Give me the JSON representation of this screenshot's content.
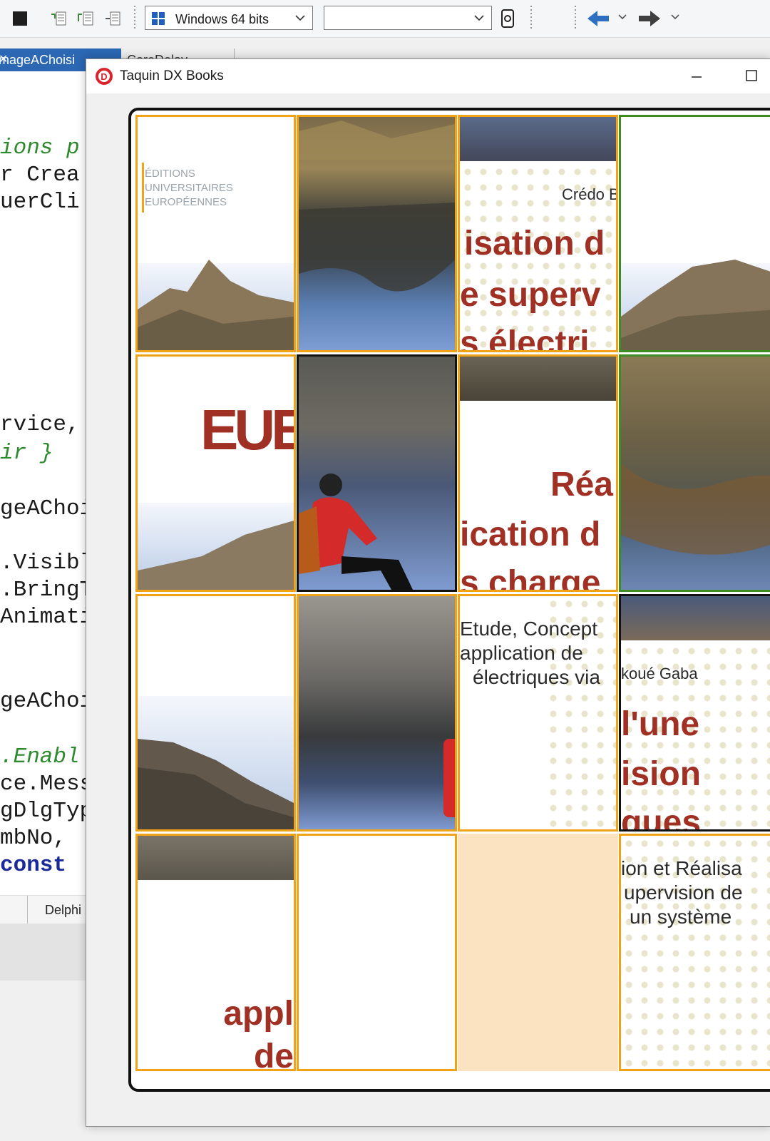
{
  "toolbar": {
    "platform_combo": "Windows 64 bits",
    "config_combo": ""
  },
  "ide": {
    "tabs": [
      {
        "label": "mageAChoisi"
      },
      {
        "label": "CoreDelay"
      }
    ],
    "code_lines": [
      {
        "text": "ions p",
        "style": "green"
      },
      {
        "text": "r Crea",
        "style": "plain"
      },
      {
        "text": "uerCli",
        "style": "plain"
      },
      {
        "text": "rvice,",
        "style": "plain"
      },
      {
        "text": "ir }",
        "style": "green"
      },
      {
        "text": "geAChoi",
        "style": "plain"
      },
      {
        "text": ".Visibl",
        "style": "plain"
      },
      {
        "text": ".BringT",
        "style": "plain"
      },
      {
        "text": "Animati",
        "style": "plain"
      },
      {
        "text": "geAChoi",
        "style": "plain"
      },
      {
        "text": ".Enabl",
        "style": "green"
      },
      {
        "text": "ce.Mess",
        "style": "plain"
      },
      {
        "text": "gDlgTyp",
        "style": "plain"
      },
      {
        "text": "mbNo,",
        "style": "plain"
      },
      {
        "text": "const",
        "style": "blue"
      }
    ],
    "status_tab": "Delphi"
  },
  "window": {
    "title": "Taquin DX Books",
    "app_icon_letter": "D",
    "minimize_glyph": "—",
    "maximize_glyph": "☐"
  },
  "book": {
    "publisher": [
      "ÉDITIONS",
      "UNIVERSITAIRES",
      "EUROPÉENNES"
    ],
    "logo": "EUE",
    "author_fragment_a": "Crédo B",
    "author_fragment_b": "koué Gaba",
    "title_fragments": {
      "t_r1c3_a": "isation d",
      "t_r1c3_b": "e superv",
      "t_r1c3_c": "s  électri",
      "t_r2c3_a": "Réa",
      "t_r2c3_b": "ication d",
      "t_r2c3_c": "s charge",
      "t_r3c4_a": "l'une",
      "t_r3c4_b": "ision",
      "t_r3c4_c": "ques",
      "t_r4c1_a": "appl",
      "t_r4c1_b": "de"
    },
    "subtitle_fragments": {
      "s_r3c3_a": "Etude, Concept",
      "s_r3c3_b": "application de",
      "s_r3c3_c": "électriques via",
      "s_r4c4_a": "ion et Réalisa",
      "s_r4c4_b": "upervision de",
      "s_r4c4_c": "un système"
    }
  },
  "colors": {
    "tile_border": "#f0a316",
    "empty_tile": "#fbe3c2",
    "title_red": "#a03024",
    "accent_blue": "#2b67b3",
    "correct_tile_border": "#3f8c22"
  }
}
